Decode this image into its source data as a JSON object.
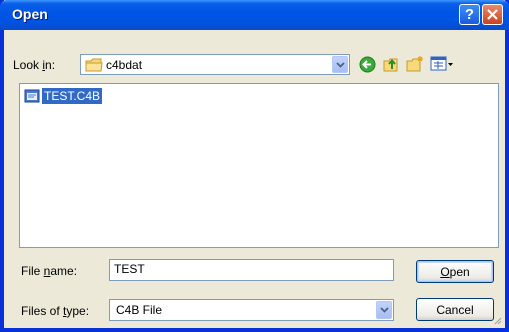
{
  "window": {
    "title": "Open"
  },
  "look_in": {
    "label_pre": "Look ",
    "label_key": "i",
    "label_post": "n:",
    "value": "c4bdat"
  },
  "files": [
    {
      "name": "TEST.C4B",
      "selected": true
    }
  ],
  "file_name": {
    "label_pre": "File ",
    "label_key": "n",
    "label_post": "ame:",
    "value": "TEST"
  },
  "file_type": {
    "label_pre": "Files of ",
    "label_key": "t",
    "label_post": "ype:",
    "value": "C4B File"
  },
  "buttons": {
    "open_key": "O",
    "open_rest": "pen",
    "cancel": "Cancel"
  },
  "colors": {
    "title_bar": "#0055E5",
    "selection": "#316AC5",
    "dialog_bg": "#ECE9D8"
  }
}
